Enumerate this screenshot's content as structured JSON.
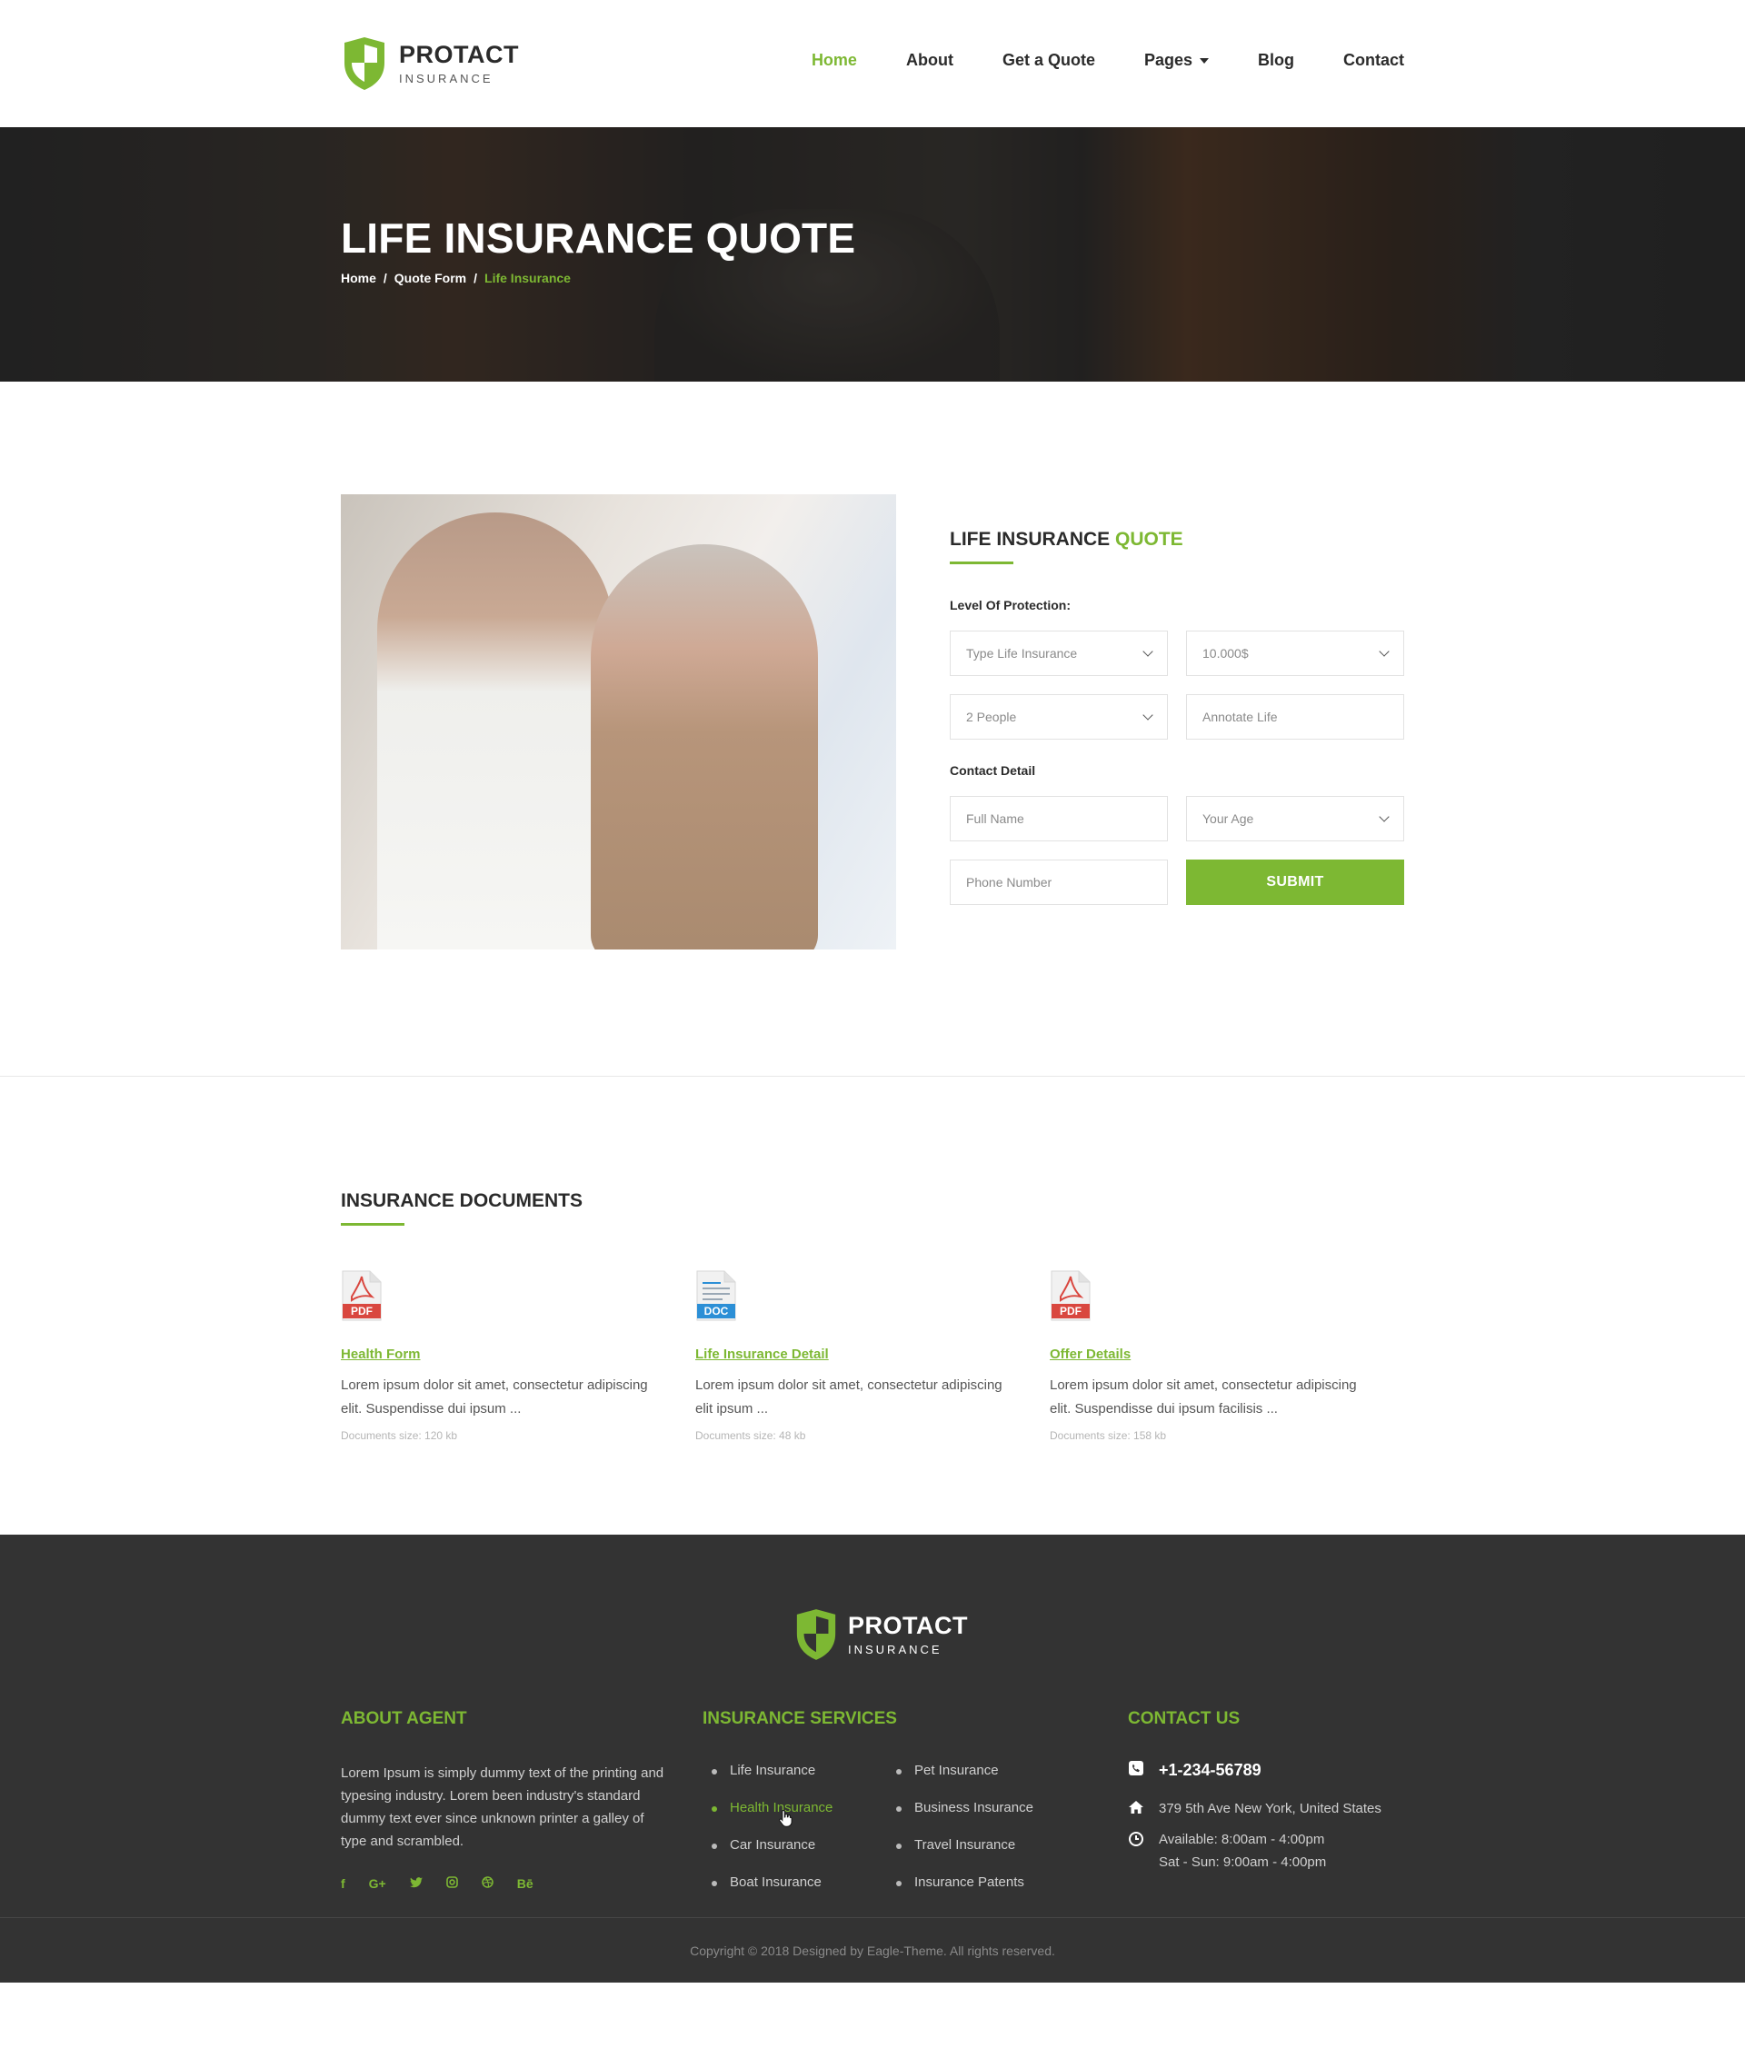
{
  "brand": {
    "name": "PROTACT",
    "sub": "INSURANCE"
  },
  "nav": [
    {
      "label": "Home",
      "active": true
    },
    {
      "label": "About"
    },
    {
      "label": "Get a Quote"
    },
    {
      "label": "Pages",
      "dropdown": true
    },
    {
      "label": "Blog"
    },
    {
      "label": "Contact"
    }
  ],
  "banner": {
    "title": "LIFE INSURANCE QUOTE",
    "breadcrumb": [
      "Home",
      "Quote Form",
      "Life Insurance"
    ]
  },
  "quote": {
    "heading_a": "LIFE INSURANCE ",
    "heading_b": "QUOTE",
    "level_label": "Level Of Protection:",
    "type_select": "Type Life Insurance",
    "amount_select": "10.000$",
    "people_select": "2 People",
    "annotate_placeholder": "Annotate Life",
    "contact_label": "Contact Detail",
    "name_placeholder": "Full Name",
    "age_select": "Your Age",
    "phone_placeholder": "Phone Number",
    "submit": "SUBMIT"
  },
  "docs": {
    "heading": "INSURANCE DOCUMENTS",
    "items": [
      {
        "type": "PDF",
        "title": "Health Form",
        "desc": "Lorem ipsum dolor sit amet, consectetur adipiscing elit. Suspendisse dui ipsum ...",
        "size": "Documents size: 120 kb"
      },
      {
        "type": "DOC",
        "title": "Life Insurance Detail",
        "desc": "Lorem ipsum dolor sit amet, consectetur adipiscing elit ipsum ...",
        "size": "Documents size: 48 kb"
      },
      {
        "type": "PDF",
        "title": "Offer Details",
        "desc": "Lorem ipsum dolor sit amet, consectetur adipiscing elit. Suspendisse dui ipsum facilisis ...",
        "size": "Documents size: 158 kb"
      }
    ]
  },
  "footer": {
    "about_title": "ABOUT AGENT",
    "about_text": "Lorem Ipsum is simply dummy text of the printing and typesing industry. Lorem been industry's standard dummy text ever since  unknown printer a galley of type and scrambled.",
    "social": [
      "f",
      "G+",
      "t",
      "ig",
      "dr",
      "Bē"
    ],
    "services_title": "INSURANCE SERVICES",
    "services_left": [
      "Life Insurance",
      "Health Insurance",
      "Car Insurance",
      "Boat Insurance"
    ],
    "services_right": [
      "Pet Insurance",
      "Business Insurance",
      "Travel Insurance",
      "Insurance Patents"
    ],
    "contact_title": "CONTACT US",
    "phone": "+1-234-56789",
    "address": "379 5th Ave New York, United States",
    "hours_1": "Available: 8:00am - 4:00pm",
    "hours_2": "Sat - Sun: 9:00am - 4:00pm",
    "copyright": "Copyright © 2018 Designed by Eagle-Theme. All rights reserved."
  },
  "colors": {
    "accent": "#7db833",
    "dark": "#333333",
    "text": "#2b2b2b"
  }
}
